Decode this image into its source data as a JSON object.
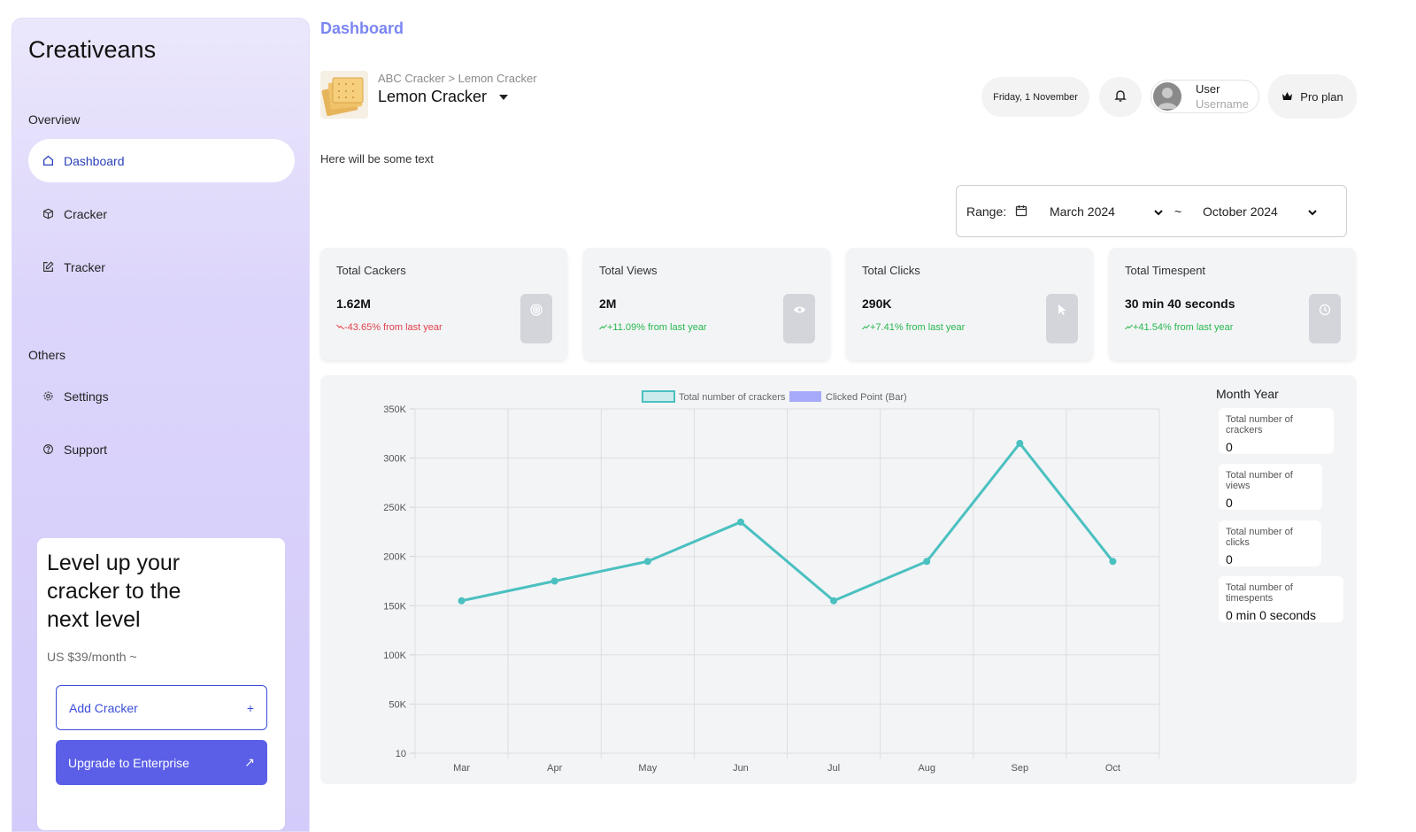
{
  "sidebar": {
    "logo": "Creativeans",
    "overview_title": "Overview",
    "others_title": "Others",
    "items": [
      {
        "label": "Dashboard"
      },
      {
        "label": "Cracker"
      },
      {
        "label": "Tracker"
      },
      {
        "label": "Settings"
      },
      {
        "label": "Support"
      }
    ],
    "promo": {
      "title": "Level up your cracker to the next level",
      "price": "US $39/month ~",
      "add_label": "Add Cracker",
      "add_icon": "+",
      "upgrade_label": "Upgrade to Enterprise",
      "upgrade_icon": "↗"
    }
  },
  "header": {
    "page_title": "Dashboard",
    "breadcrumb": "ABC Cracker > Lemon Cracker",
    "product": "Lemon Cracker",
    "date": "Friday, 1 November",
    "user_name": "User",
    "user_sub": "Username",
    "plan": "Pro plan"
  },
  "intro_text": "Here will be some text",
  "range": {
    "label": "Range:",
    "from": "March 2024",
    "separator": "~",
    "to": "October 2024"
  },
  "stats": [
    {
      "title": "Total Cackers",
      "value": "1.62M",
      "change": "-43.65% from last year",
      "trend": "down",
      "icon": "target-icon"
    },
    {
      "title": "Total Views",
      "value": "2M",
      "change": "+11.09% from last year",
      "trend": "up",
      "icon": "eye-icon"
    },
    {
      "title": "Total Clicks",
      "value": "290K",
      "change": "+7.41% from last year",
      "trend": "up",
      "icon": "cursor-icon"
    },
    {
      "title": "Total Timespent",
      "value": "30 min 40 seconds",
      "change": "+41.54% from last year",
      "trend": "up",
      "icon": "clock-icon"
    }
  ],
  "colors": {
    "accent": "#5b5fe7",
    "line": "#4bc0c0",
    "bar": "#a7aaf8",
    "down": "#e0414b",
    "up": "#28b84f"
  },
  "chart_data": {
    "type": "line",
    "categories": [
      "Mar",
      "Apr",
      "May",
      "Jun",
      "Jul",
      "Aug",
      "Sep",
      "Oct"
    ],
    "series": [
      {
        "name": "Total number of crackers",
        "values": [
          155000,
          175000,
          195000,
          235000,
          155000,
          195000,
          315000,
          195000
        ]
      },
      {
        "name": "Clicked Point (Bar)",
        "values": []
      }
    ],
    "ylim": [
      10,
      350000
    ],
    "yticks": [
      10,
      50000,
      100000,
      150000,
      200000,
      250000,
      300000,
      350000
    ],
    "ytick_labels": [
      "10",
      "50K",
      "100K",
      "150K",
      "200K",
      "250K",
      "300K",
      "350K"
    ],
    "grid": true,
    "legend_position": "top"
  },
  "month_year": {
    "title": "Month Year",
    "cards": [
      {
        "label": "Total number of crackers",
        "value": "0"
      },
      {
        "label": "Total number of views",
        "value": "0"
      },
      {
        "label": "Total number of clicks",
        "value": "0"
      },
      {
        "label": "Total number of timespents",
        "value": "0 min 0 seconds"
      }
    ]
  }
}
